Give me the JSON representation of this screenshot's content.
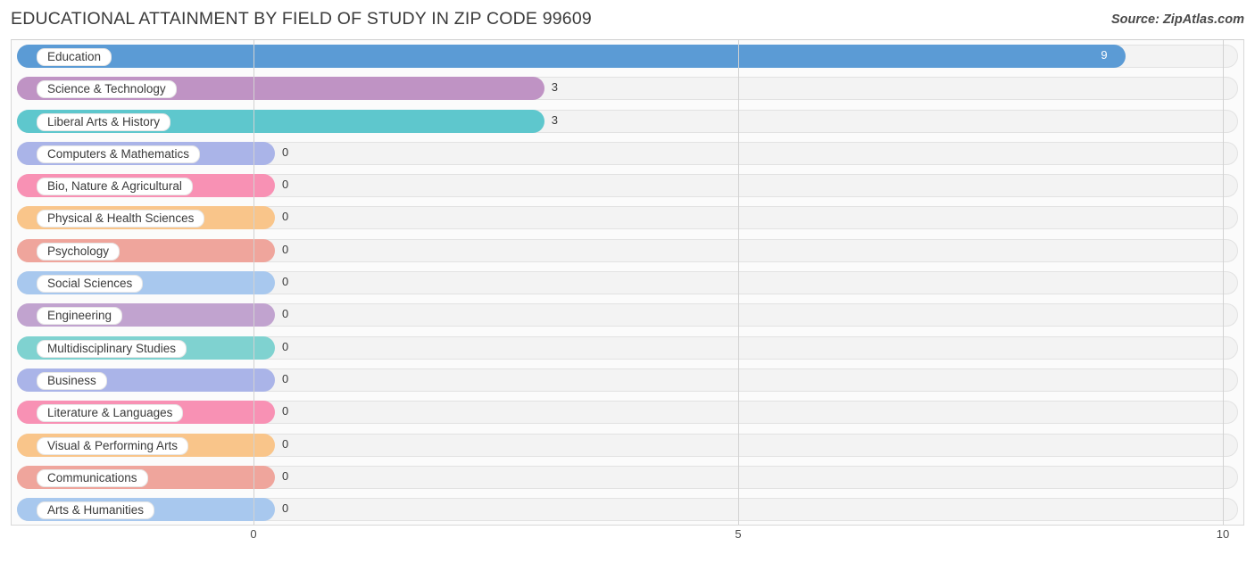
{
  "header": {
    "title": "EDUCATIONAL ATTAINMENT BY FIELD OF STUDY IN ZIP CODE 99609",
    "source": "Source: ZipAtlas.com"
  },
  "chart_data": {
    "type": "bar",
    "orientation": "horizontal",
    "title": "EDUCATIONAL ATTAINMENT BY FIELD OF STUDY IN ZIP CODE 99609",
    "xlabel": "",
    "ylabel": "",
    "xlim": [
      0,
      10
    ],
    "xticks": [
      "0",
      "5",
      "10"
    ],
    "xtick_values": [
      0,
      5,
      10
    ],
    "grid": true,
    "legend": "none",
    "categories": [
      "Education",
      "Science & Technology",
      "Liberal Arts & History",
      "Computers & Mathematics",
      "Bio, Nature & Agricultural",
      "Physical & Health Sciences",
      "Psychology",
      "Social Sciences",
      "Engineering",
      "Multidisciplinary Studies",
      "Business",
      "Literature & Languages",
      "Visual & Performing Arts",
      "Communications",
      "Arts & Humanities"
    ],
    "values": [
      9,
      3,
      3,
      0,
      0,
      0,
      0,
      0,
      0,
      0,
      0,
      0,
      0,
      0,
      0
    ],
    "value_labels": [
      "9",
      "3",
      "3",
      "0",
      "0",
      "0",
      "0",
      "0",
      "0",
      "0",
      "0",
      "0",
      "0",
      "0",
      "0"
    ],
    "colors": [
      "#5b9bd5",
      "#bf93c4",
      "#5ec7cd",
      "#aab4e8",
      "#f891b4",
      "#f9c58a",
      "#efa59c",
      "#a8c8ee",
      "#c1a3cf",
      "#7fd2d0",
      "#aab4e8",
      "#f891b4",
      "#f9c58a",
      "#efa59c",
      "#a8c8ee"
    ]
  }
}
